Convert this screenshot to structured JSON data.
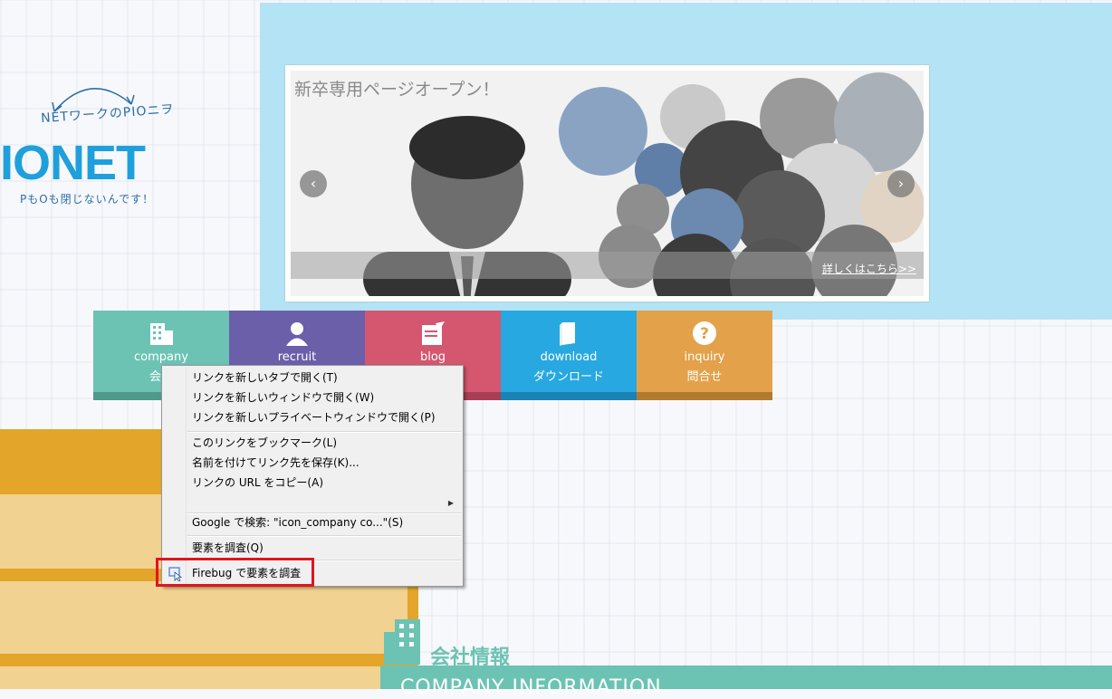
{
  "logo": {
    "tagline_top": "NETワークのPIOニヲ",
    "brand": "IONET",
    "tagline_bottom": "PもOも閉じないんです！"
  },
  "slider": {
    "title": "新卒専用ページオープン！",
    "caption_link": "詳しくはこちら>>",
    "prev_icon": "chevron-left-icon",
    "next_icon": "chevron-right-icon"
  },
  "nav": [
    {
      "en": "company",
      "jp": "会社",
      "color": "#6cc3b3",
      "bar": "#4e9a8b",
      "icon": "building-icon"
    },
    {
      "en": "recruit",
      "jp": "",
      "color": "#6b5faa",
      "bar": "#4f4586",
      "icon": "person-icon"
    },
    {
      "en": "blog",
      "jp": "",
      "color": "#d4566f",
      "bar": "#a83e55",
      "icon": "blog-icon"
    },
    {
      "en": "download",
      "jp": "ダウンロード",
      "color": "#27a8e0",
      "bar": "#1b82b4",
      "icon": "book-icon"
    },
    {
      "en": "inquiry",
      "jp": "問合せ",
      "color": "#e3a14a",
      "bar": "#b27a2e",
      "icon": "question-icon"
    }
  ],
  "company_section": {
    "title": "会社情報",
    "subtitle": "COMPANY INFORMATION"
  },
  "context_menu": {
    "items": [
      "リンクを新しいタブで開く(T)",
      "リンクを新しいウィンドウで開く(W)",
      "リンクを新しいプライベートウィンドウで開く(P)",
      "このリンクをブックマーク(L)",
      "名前を付けてリンク先を保存(K)...",
      "リンクの URL をコピー(A)",
      "",
      "Google で検索: \"icon_company co...\"(S)",
      "要素を調査(Q)",
      "Firebug で要素を調査"
    ]
  }
}
